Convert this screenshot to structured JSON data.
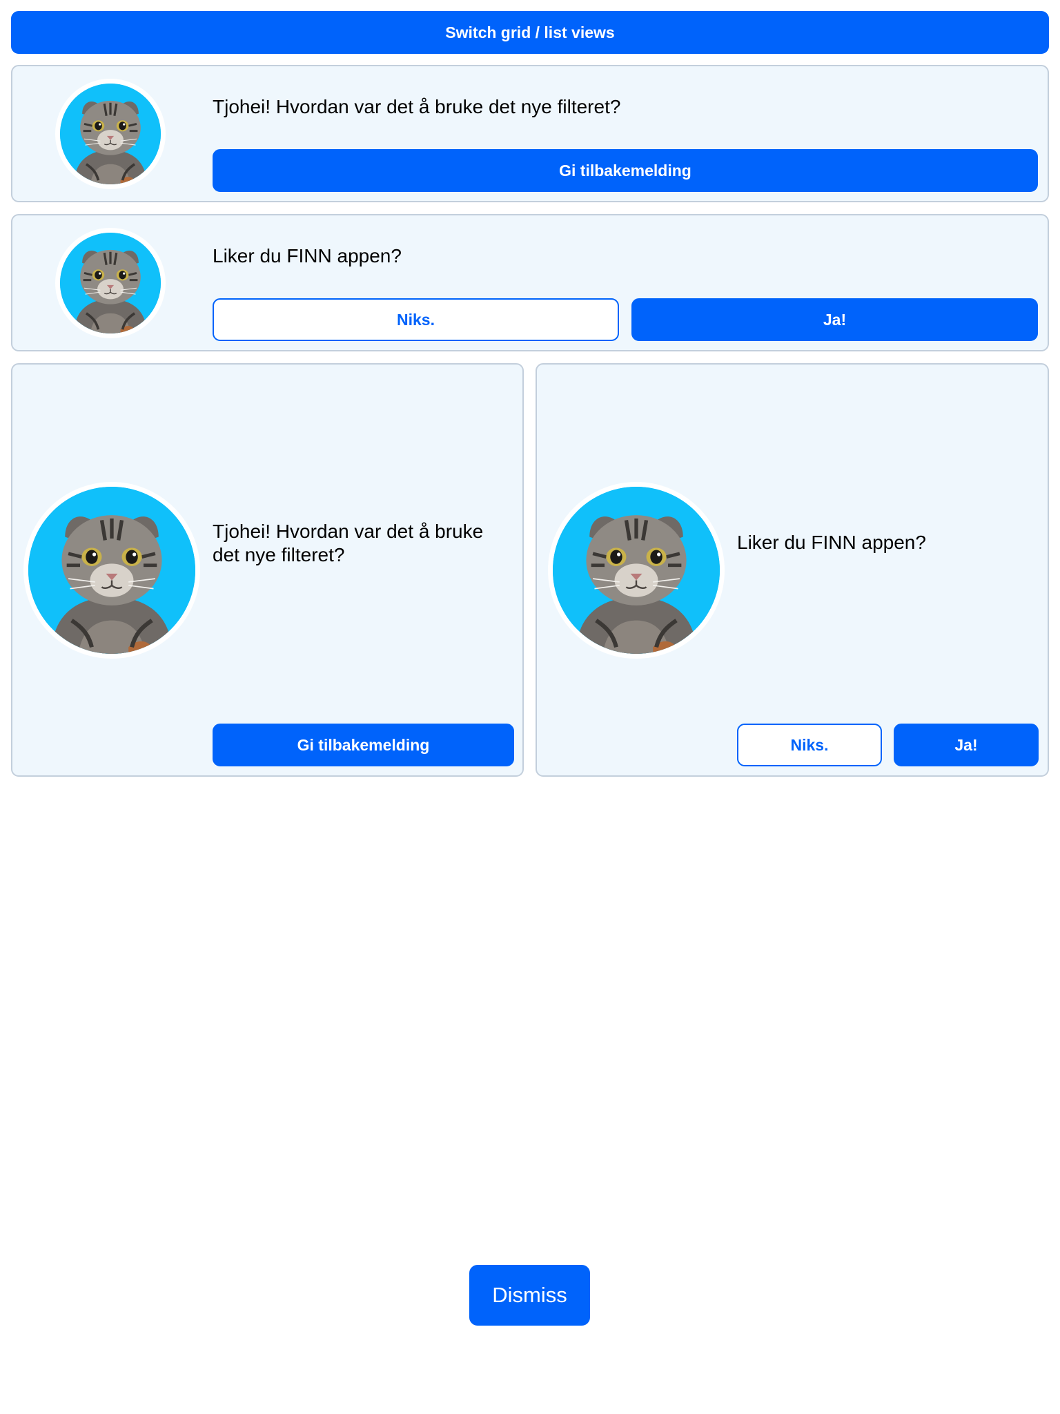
{
  "toolbar": {
    "switch_label": "Switch grid / list views"
  },
  "list_view": {
    "feedback_card": {
      "message": "Tjohei! Hvordan var det å bruke det nye filteret?",
      "primary_label": "Gi tilbakemelding"
    },
    "rating_card": {
      "message": "Liker du FINN appen?",
      "secondary_label": "Niks.",
      "primary_label": "Ja!"
    }
  },
  "grid_view": {
    "feedback_card": {
      "message": "Tjohei! Hvordan var det å bruke det nye filteret?",
      "primary_label": "Gi tilbakemelding"
    },
    "rating_card": {
      "message": "Liker du FINN appen?",
      "secondary_label": "Niks.",
      "primary_label": "Ja!"
    }
  },
  "footer": {
    "dismiss_label": "Dismiss"
  },
  "colors": {
    "brand_primary": "#0063fb",
    "card_background": "#eff7fd",
    "card_border": "#c3cfdc",
    "avatar_background": "#10c0fa"
  },
  "icons": {
    "avatar": "cat-avatar-icon"
  }
}
